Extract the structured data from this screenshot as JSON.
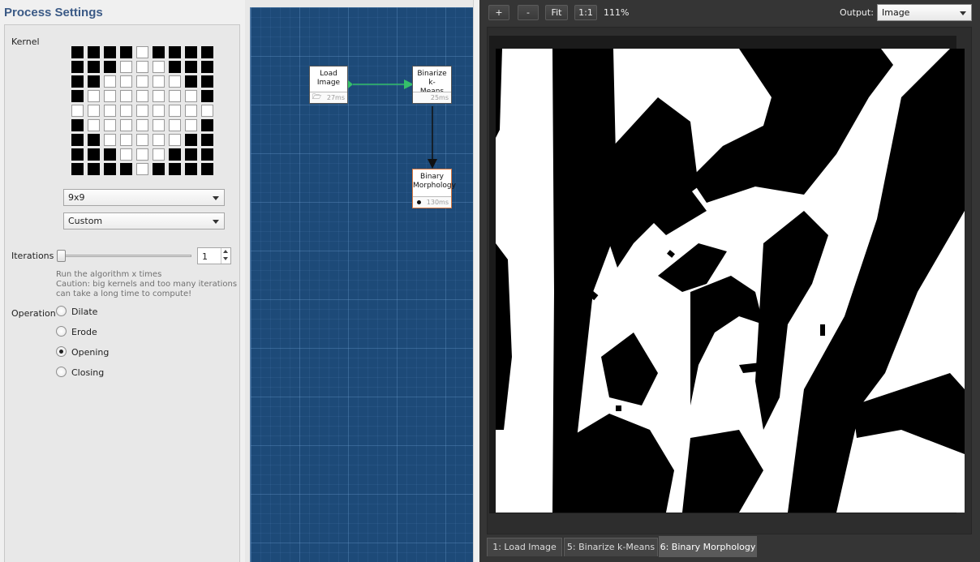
{
  "left": {
    "title": "Process Settings",
    "kernel_label": "Kernel",
    "kernel": [
      [
        1,
        1,
        1,
        1,
        0,
        1,
        1,
        1,
        1
      ],
      [
        1,
        1,
        1,
        0,
        0,
        0,
        1,
        1,
        1
      ],
      [
        1,
        1,
        0,
        0,
        0,
        0,
        0,
        1,
        1
      ],
      [
        1,
        0,
        0,
        0,
        0,
        0,
        0,
        0,
        1
      ],
      [
        0,
        0,
        0,
        0,
        0,
        0,
        0,
        0,
        0
      ],
      [
        1,
        0,
        0,
        0,
        0,
        0,
        0,
        0,
        1
      ],
      [
        1,
        1,
        0,
        0,
        0,
        0,
        0,
        1,
        1
      ],
      [
        1,
        1,
        1,
        0,
        0,
        0,
        1,
        1,
        1
      ],
      [
        1,
        1,
        1,
        1,
        0,
        1,
        1,
        1,
        1
      ]
    ],
    "size_value": "9x9",
    "shape_value": "Custom",
    "iterations_label": "Iterations",
    "iterations_value": "1",
    "help_line1": "Run the algorithm x times",
    "help_line2": "Caution: big kernels and too many iterations",
    "help_line3": "can take a long time to compute!",
    "operation_label": "Operation",
    "operations": [
      {
        "label": "Dilate",
        "selected": false
      },
      {
        "label": "Erode",
        "selected": false
      },
      {
        "label": "Opening",
        "selected": true
      },
      {
        "label": "Closing",
        "selected": false
      }
    ]
  },
  "graph": {
    "nodes": [
      {
        "line1": "Load",
        "line2": "Image",
        "time": "27ms",
        "footer_icon": "folder-icon"
      },
      {
        "line1": "Binarize k-",
        "line2": "Means",
        "time": "25ms",
        "footer_icon": ""
      },
      {
        "line1": "Binary",
        "line2": "Morphology",
        "time": "130ms",
        "footer_icon": "dot-icon"
      }
    ],
    "link_color": "#35c06a"
  },
  "viewer": {
    "buttons": [
      "+",
      "-",
      "Fit",
      "1:1"
    ],
    "zoom": "111%",
    "output_label": "Output:",
    "output_value": "Image",
    "tabs": [
      {
        "label": "1: Load Image",
        "active": false
      },
      {
        "label": "5: Binarize k-Means",
        "active": false
      },
      {
        "label": "6: Binary Morphology",
        "active": true
      }
    ]
  },
  "colors": {
    "graph_bg": "#1d4a78",
    "viewer_bg": "#353535",
    "title": "#3b5a86",
    "selected_node_border": "#d9783e"
  }
}
